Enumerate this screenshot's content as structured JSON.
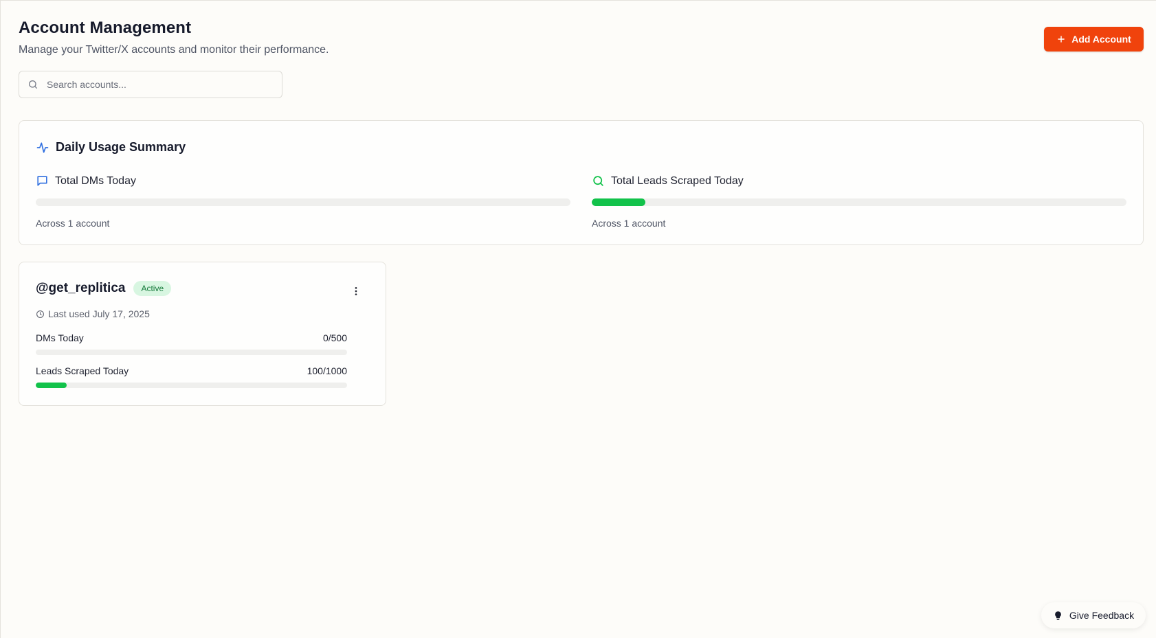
{
  "header": {
    "title": "Account Management",
    "subtitle": "Manage your Twitter/X accounts and monitor their performance.",
    "add_button_label": "Add Account"
  },
  "search": {
    "placeholder": "Search accounts...",
    "value": ""
  },
  "summary": {
    "title": "Daily Usage Summary",
    "dms": {
      "label": "Total DMs Today",
      "progress_percent": 0,
      "note": "Across 1 account"
    },
    "leads": {
      "label": "Total Leads Scraped Today",
      "progress_percent": 10,
      "note": "Across 1 account"
    }
  },
  "accounts": [
    {
      "handle": "@get_replitica",
      "status": "Active",
      "last_used": "Last used July 17, 2025",
      "metrics": [
        {
          "label": "DMs Today",
          "value": "0/500",
          "progress_percent": 0
        },
        {
          "label": "Leads Scraped Today",
          "value": "100/1000",
          "progress_percent": 10
        }
      ]
    }
  ],
  "feedback": {
    "label": "Give Feedback"
  },
  "colors": {
    "accent": "#f0430c",
    "progress": "#12c24a",
    "activity_icon": "#2f6fe0",
    "leads_icon": "#12c24a",
    "badge_bg": "#d8f6e1",
    "badge_text": "#157a3a"
  },
  "icons": {
    "add": "plus-icon",
    "search": "search-icon",
    "summary": "activity-icon",
    "dms": "message-square-icon",
    "leads": "search-icon",
    "menu": "more-vertical-icon",
    "last_used": "clock-icon",
    "feedback": "lightbulb-icon"
  }
}
